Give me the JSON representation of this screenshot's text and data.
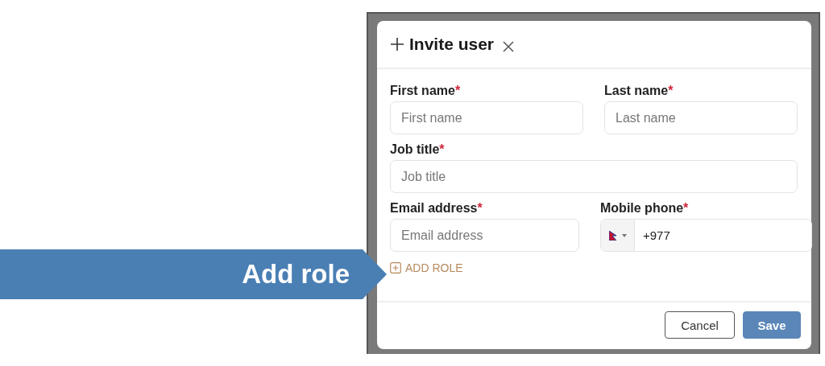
{
  "callout": {
    "label": "Add role"
  },
  "dialog": {
    "title": "Invite user",
    "rows": [
      [
        {
          "kind": "text",
          "label": "First name",
          "required_mark": "*",
          "placeholder": "First name"
        },
        {
          "kind": "text",
          "label": "Last name",
          "required_mark": "*",
          "placeholder": "Last name"
        }
      ],
      [
        {
          "kind": "text",
          "label": "Job title",
          "required_mark": "*",
          "placeholder": "Job title"
        }
      ],
      [
        {
          "kind": "text",
          "label": "Email address",
          "required_mark": "*",
          "placeholder": "Email address"
        },
        {
          "kind": "phone",
          "label": "Mobile phone",
          "required_mark": "*",
          "value": "+977"
        }
      ]
    ],
    "add_link": "ADD ROLE",
    "buttons": [
      {
        "label": "Cancel",
        "kind": "secondary"
      },
      {
        "label": "Save",
        "kind": "primary"
      }
    ]
  }
}
